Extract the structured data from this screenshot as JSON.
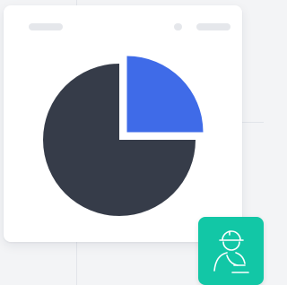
{
  "card": {
    "header": {
      "title": "",
      "actions": ""
    }
  },
  "chart_data": {
    "type": "pie",
    "slices": [
      {
        "value": 75,
        "color": "#363c49",
        "exploded": false
      },
      {
        "value": 25,
        "color": "#3f6be8",
        "exploded": true
      }
    ]
  },
  "badge": {
    "icon": "user-with-hardhat-icon",
    "color": "#12c7a6"
  }
}
